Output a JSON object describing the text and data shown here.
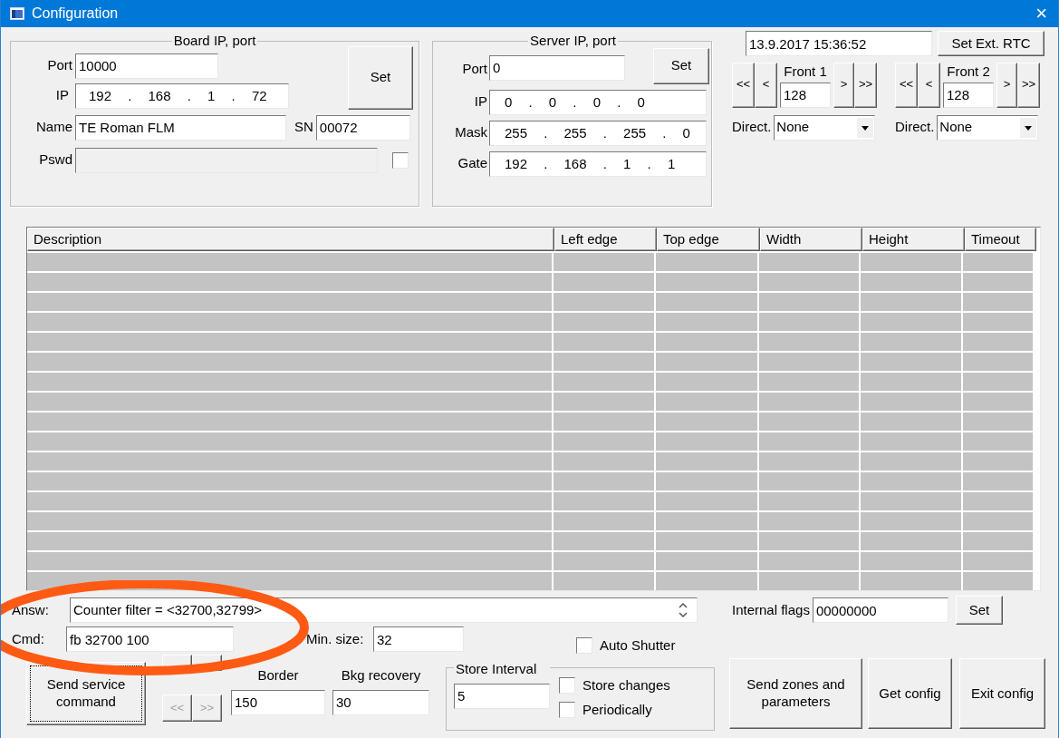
{
  "window": {
    "title": "Configuration",
    "close": "×"
  },
  "board": {
    "title": "Board IP, port",
    "port_label": "Port",
    "port": "10000",
    "ip_label": "IP",
    "ip": "192 . 168 . 1 . 72",
    "name_label": "Name",
    "name": "TE Roman FLM",
    "sn_label": "SN",
    "sn": "00072",
    "pswd_label": "Pswd",
    "pswd_disabled": true,
    "pswd_checked": false,
    "set": "Set"
  },
  "server": {
    "title": "Server IP, port",
    "port_label": "Port",
    "port": "0",
    "set": "Set",
    "ip_label": "IP",
    "ip": "0 . 0 . 0 . 0",
    "mask_label": "Mask",
    "mask": "255 . 255 . 255 . 0",
    "gate_label": "Gate",
    "gate": "192 . 168 . 1 . 1"
  },
  "rtc": {
    "datetime": "13.9.2017 15:36:52",
    "button": "Set Ext. RTC"
  },
  "fronts": [
    {
      "title": "Front 1",
      "value": "128",
      "prev_fast": "<<",
      "prev": "<",
      "next": ">",
      "next_fast": ">>",
      "direct_label": "Direct.",
      "direct": "None"
    },
    {
      "title": "Front 2",
      "value": "128",
      "prev_fast": "<<",
      "prev": "<",
      "next": ">",
      "next_fast": ">>",
      "direct_label": "Direct.",
      "direct": "None"
    }
  ],
  "table": {
    "columns": [
      "Description",
      "Left edge",
      "Top edge",
      "Width",
      "Height",
      "Timeout"
    ]
  },
  "bottom": {
    "answ_label": "Answ:",
    "answ": "Counter filter = <32700,32799>",
    "cmd_label": "Cmd:",
    "cmd": "fb 32700 100",
    "min_size_label": "Min. size:",
    "min_size": "32",
    "auto_shutter": {
      "label": "Auto Shutter",
      "checked": false
    },
    "internal_flags_label": "Internal flags",
    "internal_flags": "00000000",
    "flags_set": "Set",
    "send_service": "Send service command",
    "nav": [
      {
        "label": "<<",
        "disabled": true
      },
      {
        "label": ">>",
        "disabled": true
      }
    ],
    "border_label": "Border",
    "border": "150",
    "bkg_label": "Bkg recovery",
    "bkg": "30",
    "store_interval": {
      "title": "Store Interval",
      "value": "5",
      "options": [
        {
          "label": "Store changes",
          "checked": false
        },
        {
          "label": "Periodically",
          "checked": false
        }
      ]
    },
    "buttons": [
      "Send zones and parameters",
      "Get config",
      "Exit config"
    ]
  }
}
